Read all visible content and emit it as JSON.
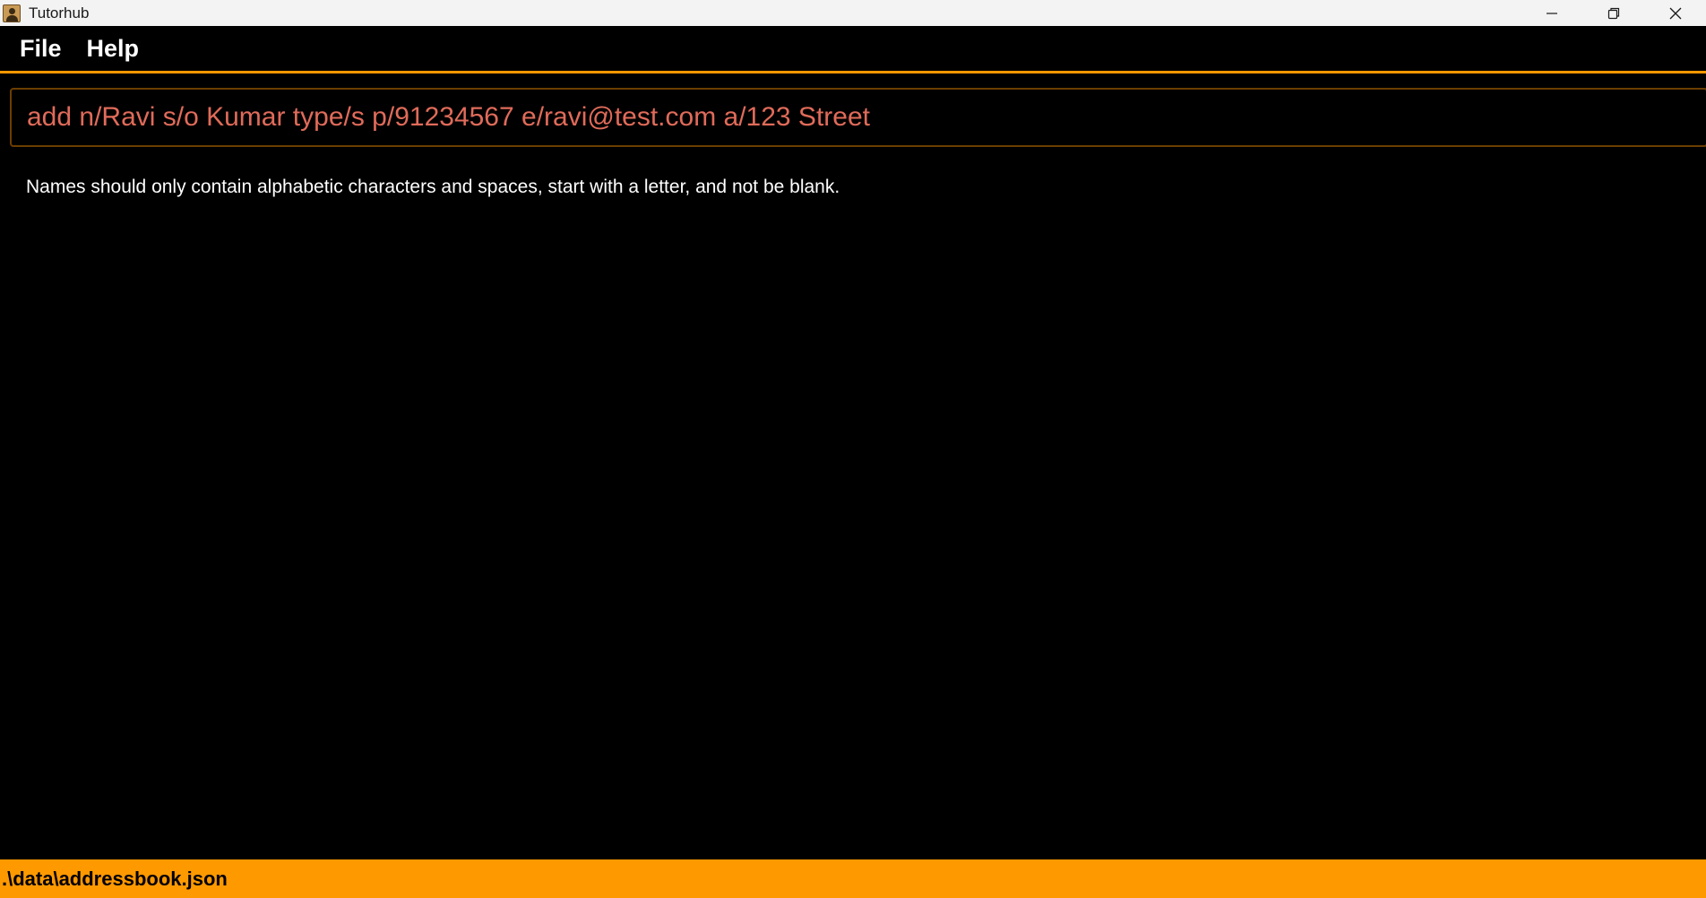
{
  "window": {
    "title": "Tutorhub",
    "controls": [
      {
        "name": "minimize",
        "icon": "minimize-icon"
      },
      {
        "name": "restore",
        "icon": "restore-icon"
      },
      {
        "name": "close",
        "icon": "close-icon"
      }
    ]
  },
  "menubar": {
    "items": [
      {
        "label": "File"
      },
      {
        "label": "Help"
      }
    ]
  },
  "command_box": {
    "value": "add n/Ravi s/o Kumar type/s p/91234567 e/ravi@test.com a/123 Street",
    "text_color": "#e06b5a"
  },
  "result_display": {
    "message": "Names should only contain alphabetic characters and spaces, start with a letter, and not be blank."
  },
  "statusbar": {
    "path": ".\\data\\addressbook.json",
    "background": "#ff9900"
  },
  "theme": {
    "background": "#000000",
    "accent": "#ff9900"
  }
}
